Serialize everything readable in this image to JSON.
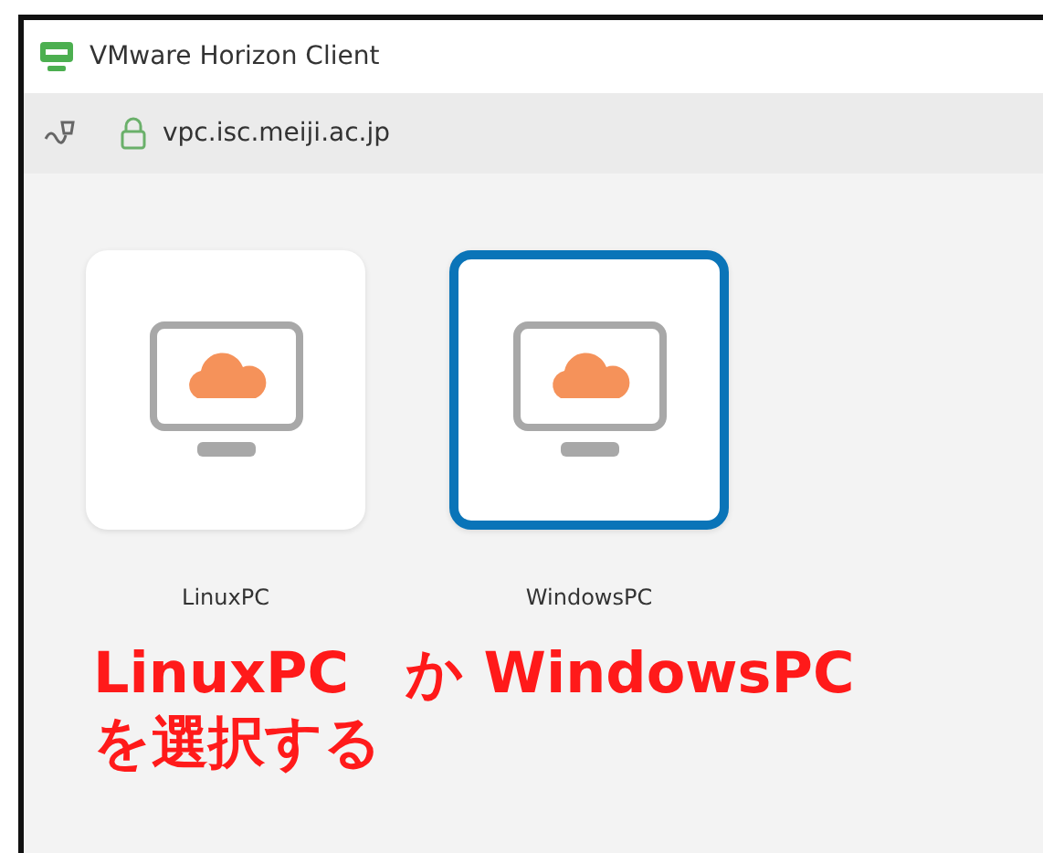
{
  "window": {
    "title": "VMware Horizon Client"
  },
  "toolbar": {
    "server": "vpc.isc.meiji.ac.jp"
  },
  "desktops": [
    {
      "name": "LinuxPC",
      "selected": false
    },
    {
      "name": "WindowsPC",
      "selected": true
    }
  ],
  "annotation": {
    "lines": [
      "LinuxPC　か WindowsPC",
      "を選択する"
    ]
  }
}
